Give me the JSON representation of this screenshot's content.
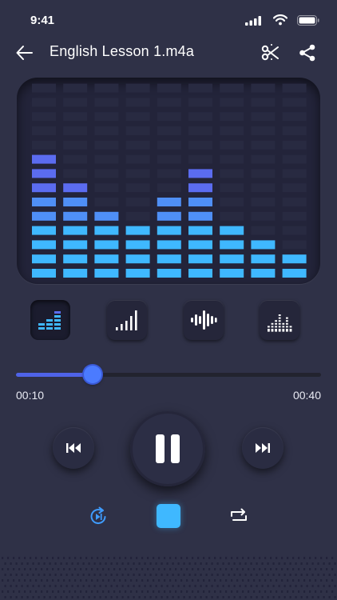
{
  "status_bar": {
    "time": "9:41"
  },
  "header": {
    "title": "English Lesson 1.m4a",
    "icons": {
      "back": "arrow-left-icon",
      "cut": "scissors-icon",
      "share": "share-icon"
    }
  },
  "visualizer": {
    "columns": [
      9,
      7,
      5,
      4,
      6,
      8,
      4,
      3,
      2
    ],
    "max_levels": 14,
    "colors": {
      "low": "#3fb8ff",
      "high": "#5b6cf0",
      "panel": "#23243a"
    }
  },
  "modes": [
    {
      "name": "bars-mode",
      "icon": "equalizer-bars-icon",
      "active": true
    },
    {
      "name": "rising-bars-mode",
      "icon": "signal-bars-icon",
      "active": false
    },
    {
      "name": "waveform-mode",
      "icon": "waveform-icon",
      "active": false
    },
    {
      "name": "dots-mode",
      "icon": "dot-spectrum-icon",
      "active": false
    }
  ],
  "player": {
    "current_time": "00:10",
    "total_time": "00:40",
    "progress": 0.25,
    "accent": "#4f63e8"
  },
  "controls": {
    "prev": "skip-previous-icon",
    "play": "pause-icon",
    "next": "skip-next-icon",
    "replay": "replay-icon",
    "stop": "stop-icon",
    "repeat": "repeat-icon"
  }
}
